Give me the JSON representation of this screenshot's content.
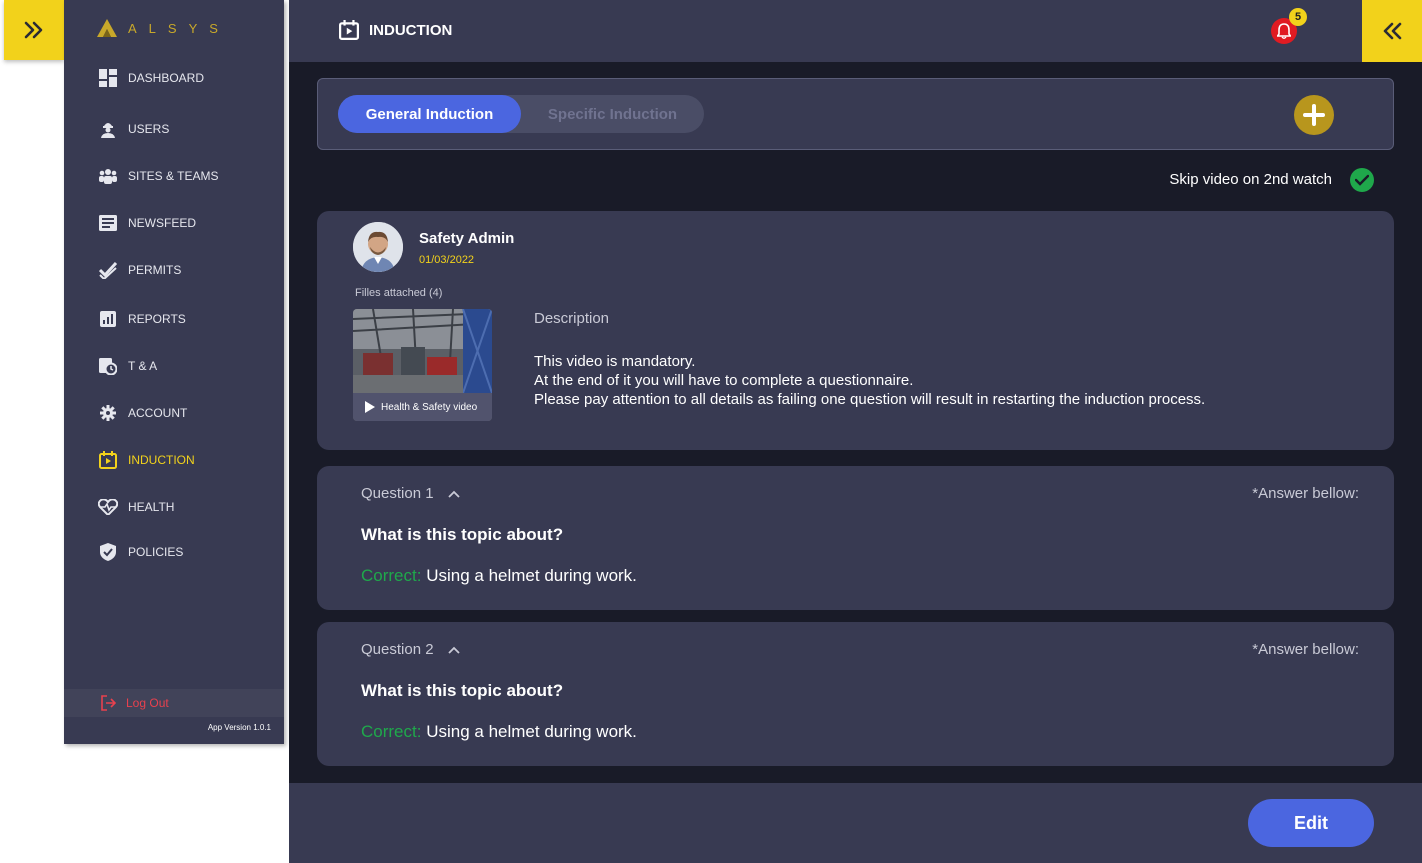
{
  "brand": {
    "name": "ALSYS"
  },
  "sidebar": {
    "items": [
      {
        "label": "DASHBOARD",
        "icon": "dashboard-icon"
      },
      {
        "label": "USERS",
        "icon": "users-icon"
      },
      {
        "label": "SITES & TEAMS",
        "icon": "teams-icon"
      },
      {
        "label": "NEWSFEED",
        "icon": "newsfeed-icon"
      },
      {
        "label": "PERMITS",
        "icon": "permits-icon"
      },
      {
        "label": "REPORTS",
        "icon": "reports-icon"
      },
      {
        "label": "T & A",
        "icon": "time-attendance-icon"
      },
      {
        "label": "ACCOUNT",
        "icon": "gear-icon"
      },
      {
        "label": "INDUCTION",
        "icon": "induction-icon",
        "active": true
      },
      {
        "label": "HEALTH",
        "icon": "heart-icon"
      },
      {
        "label": "POLICIES",
        "icon": "shield-icon"
      }
    ],
    "logout_label": "Log Out",
    "version": "App Version 1.0.1"
  },
  "header": {
    "title": "INDUCTION",
    "notification_count": "5"
  },
  "tabs": {
    "general": "General Induction",
    "specific": "Specific Induction",
    "active": "general"
  },
  "skip_label": "Skip video on 2nd watch",
  "post": {
    "author": "Safety Admin",
    "date": "01/03/2022",
    "files_label": "Filles attached (4)",
    "video_caption": "Health & Safety video",
    "description_title": "Description",
    "description_lines": [
      "This video is mandatory.",
      "At the end of it you will have to complete a questionnaire.",
      "Please pay attention to all details as failing one question will result in restarting the induction process."
    ]
  },
  "questions": [
    {
      "label": "Question 1",
      "hint": "*Answer bellow:",
      "text": "What is this topic about?",
      "correct_prefix": "Correct:",
      "answer": "Using a helmet during work."
    },
    {
      "label": "Question 2",
      "hint": "*Answer bellow:",
      "text": "What is this topic about?",
      "correct_prefix": "Correct:",
      "answer": "Using a helmet during work."
    }
  ],
  "footer": {
    "edit_label": "Edit"
  },
  "colors": {
    "accent_yellow": "#f2d21b",
    "primary_blue": "#4b66e0",
    "panel": "#383a52",
    "background": "#191b28",
    "success": "#1fa84b",
    "danger": "#e01b22"
  }
}
